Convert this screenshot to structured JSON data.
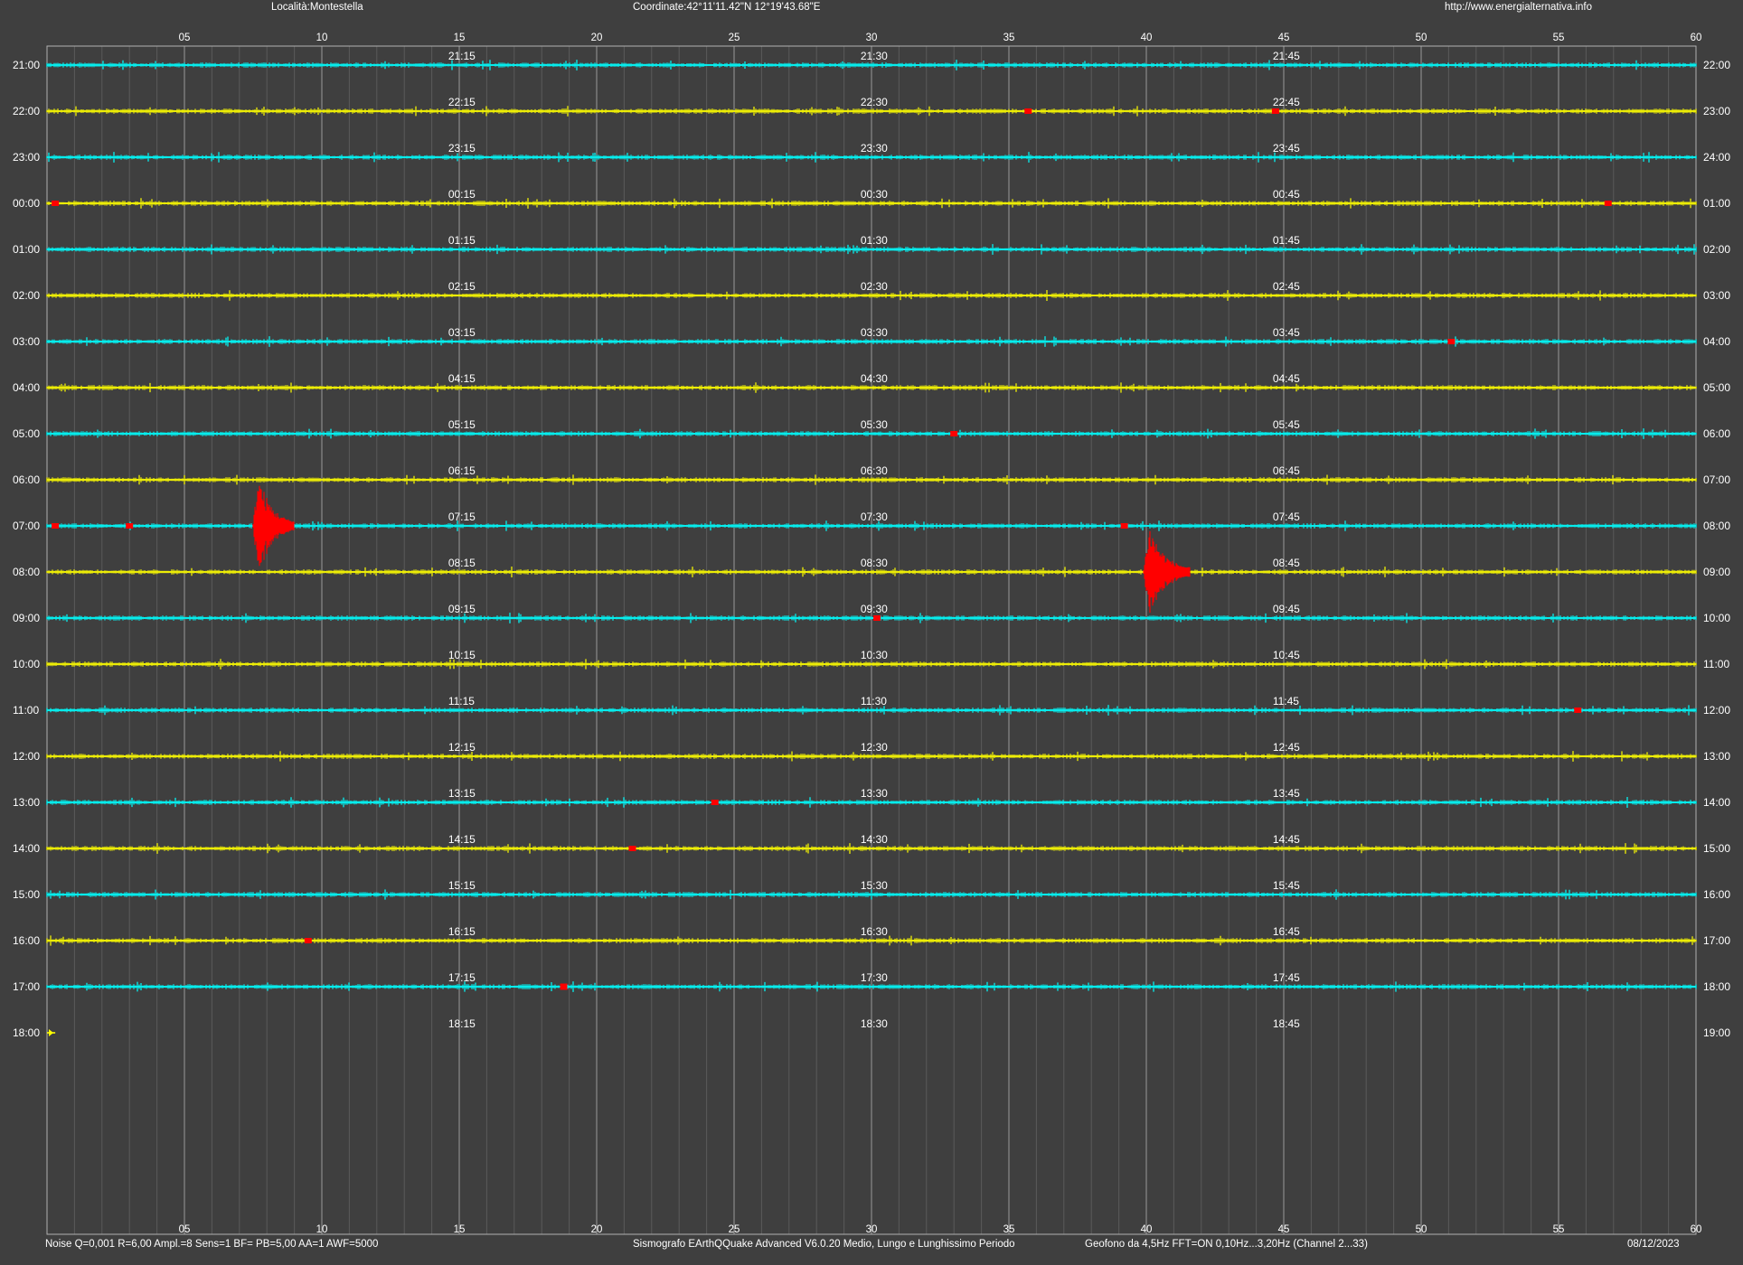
{
  "header": {
    "location": "Località:Montestella",
    "coordinates": "Coordinate:42°11'11.42\"N  12°19'43.68\"E",
    "url": "http://www.energialternativa.info"
  },
  "footer": {
    "params": "Noise Q=0,001 R=6,00 Ampl.=8 Sens=1 BF= PB=5,00 AA=1 AWF=5000",
    "software": "Sismografo  EArthQQuake Advanced V6.0.20  Medio, Lungo e Lunghissimo Periodo",
    "sensor": "Geofono da 4,5Hz FFT=ON 0,10Hz...3,20Hz      (Channel 2...33)",
    "date": "08/12/2023"
  },
  "colors": {
    "background": "#3f3f3f",
    "trace_a": "#00ffff",
    "trace_b": "#ffff00",
    "event": "#ff0000",
    "grid_major": "#9a9a9a",
    "grid_minor": "#5a5a5a",
    "text": "#ffffff"
  },
  "chart_data": {
    "type": "helicorder",
    "x_unit": "minutes",
    "xlim": [
      0,
      60
    ],
    "x_ticks": [
      "05",
      "10",
      "15",
      "20",
      "25",
      "30",
      "35",
      "40",
      "45",
      "50",
      "55",
      "60"
    ],
    "rows": [
      {
        "left": "21:00",
        "right": "22:00",
        "q15": "21:15",
        "q30": "21:30",
        "q45": "21:45",
        "color": "cyan"
      },
      {
        "left": "22:00",
        "right": "23:00",
        "q15": "22:15",
        "q30": "22:30",
        "q45": "22:45",
        "color": "yellow"
      },
      {
        "left": "23:00",
        "right": "24:00",
        "q15": "23:15",
        "q30": "23:30",
        "q45": "23:45",
        "color": "cyan"
      },
      {
        "left": "00:00",
        "right": "01:00",
        "q15": "00:15",
        "q30": "00:30",
        "q45": "00:45",
        "color": "yellow"
      },
      {
        "left": "01:00",
        "right": "02:00",
        "q15": "01:15",
        "q30": "01:30",
        "q45": "01:45",
        "color": "cyan"
      },
      {
        "left": "02:00",
        "right": "03:00",
        "q15": "02:15",
        "q30": "02:30",
        "q45": "02:45",
        "color": "yellow"
      },
      {
        "left": "03:00",
        "right": "04:00",
        "q15": "03:15",
        "q30": "03:30",
        "q45": "03:45",
        "color": "cyan"
      },
      {
        "left": "04:00",
        "right": "05:00",
        "q15": "04:15",
        "q30": "04:30",
        "q45": "04:45",
        "color": "yellow"
      },
      {
        "left": "05:00",
        "right": "06:00",
        "q15": "05:15",
        "q30": "05:30",
        "q45": "05:45",
        "color": "cyan"
      },
      {
        "left": "06:00",
        "right": "07:00",
        "q15": "06:15",
        "q30": "06:30",
        "q45": "06:45",
        "color": "yellow"
      },
      {
        "left": "07:00",
        "right": "08:00",
        "q15": "07:15",
        "q30": "07:30",
        "q45": "07:45",
        "color": "cyan"
      },
      {
        "left": "08:00",
        "right": "09:00",
        "q15": "08:15",
        "q30": "08:30",
        "q45": "08:45",
        "color": "yellow"
      },
      {
        "left": "09:00",
        "right": "10:00",
        "q15": "09:15",
        "q30": "09:30",
        "q45": "09:45",
        "color": "cyan"
      },
      {
        "left": "10:00",
        "right": "11:00",
        "q15": "10:15",
        "q30": "10:30",
        "q45": "10:45",
        "color": "yellow"
      },
      {
        "left": "11:00",
        "right": "12:00",
        "q15": "11:15",
        "q30": "11:30",
        "q45": "11:45",
        "color": "cyan"
      },
      {
        "left": "12:00",
        "right": "13:00",
        "q15": "12:15",
        "q30": "12:30",
        "q45": "12:45",
        "color": "yellow"
      },
      {
        "left": "13:00",
        "right": "14:00",
        "q15": "13:15",
        "q30": "13:30",
        "q45": "13:45",
        "color": "cyan"
      },
      {
        "left": "14:00",
        "right": "15:00",
        "q15": "14:15",
        "q30": "14:30",
        "q45": "14:45",
        "color": "yellow"
      },
      {
        "left": "15:00",
        "right": "16:00",
        "q15": "15:15",
        "q30": "15:30",
        "q45": "15:45",
        "color": "cyan"
      },
      {
        "left": "16:00",
        "right": "17:00",
        "q15": "16:15",
        "q30": "16:30",
        "q45": "16:45",
        "color": "yellow"
      },
      {
        "left": "17:00",
        "right": "18:00",
        "q15": "17:15",
        "q30": "17:30",
        "q45": "17:45",
        "color": "cyan"
      },
      {
        "left": "18:00",
        "right": "19:00",
        "q15": "18:15",
        "q30": "18:30",
        "q45": "18:45",
        "color": "yellow",
        "end_minute": 0.3
      }
    ],
    "events": [
      {
        "row": 1,
        "minute": 35.7,
        "amplitude": 0.06
      },
      {
        "row": 1,
        "minute": 44.7,
        "amplitude": 0.05
      },
      {
        "row": 3,
        "minute": 0.3,
        "amplitude": 0.05
      },
      {
        "row": 3,
        "minute": 56.8,
        "amplitude": 0.05
      },
      {
        "row": 6,
        "minute": 51.1,
        "amplitude": 0.04
      },
      {
        "row": 8,
        "minute": 33.0,
        "amplitude": 0.04
      },
      {
        "row": 10,
        "minute": 0.3,
        "amplitude": 0.05
      },
      {
        "row": 10,
        "minute": 3.0,
        "amplitude": 0.05
      },
      {
        "row": 10,
        "minute": 7.5,
        "amplitude": 1.0,
        "duration": 1.5
      },
      {
        "row": 10,
        "minute": 39.2,
        "amplitude": 0.05
      },
      {
        "row": 11,
        "minute": 39.9,
        "amplitude": 0.9,
        "duration": 1.7
      },
      {
        "row": 12,
        "minute": 30.2,
        "amplitude": 0.04
      },
      {
        "row": 14,
        "minute": 55.7,
        "amplitude": 0.06
      },
      {
        "row": 16,
        "minute": 24.3,
        "amplitude": 0.04
      },
      {
        "row": 17,
        "minute": 21.3,
        "amplitude": 0.05
      },
      {
        "row": 19,
        "minute": 9.5,
        "amplitude": 0.05
      },
      {
        "row": 20,
        "minute": 18.8,
        "amplitude": 0.12
      }
    ]
  }
}
